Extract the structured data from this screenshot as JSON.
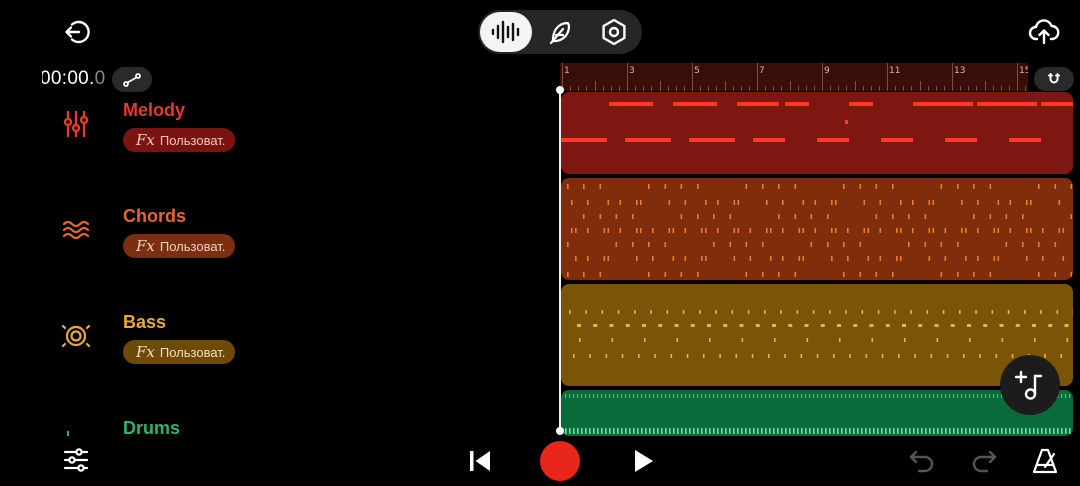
{
  "header": {
    "exit_icon": "exit-icon",
    "upload_icon": "cloud-upload-icon",
    "modes": [
      {
        "name": "waveform",
        "icon": "waveform-icon",
        "active": true
      },
      {
        "name": "feather",
        "icon": "feather-icon",
        "active": false
      },
      {
        "name": "settings",
        "icon": "hexagon-settings-icon",
        "active": false
      }
    ]
  },
  "transport": {
    "time_main": "00:00.",
    "time_frac": "0",
    "time_prefix": ")"
  },
  "ruler": {
    "numbers": [
      "1",
      "3",
      "5",
      "7",
      "9",
      "11",
      "13",
      "15"
    ]
  },
  "tracks": [
    {
      "name": "Melody",
      "fx_label": "Fx",
      "preset": "Пользоват.",
      "color": "#e63a2e",
      "fx_bg": "#7a1410",
      "lane_color": "#7e1712",
      "icon": "sliders-vertical-icon"
    },
    {
      "name": "Chords",
      "fx_label": "Fx",
      "preset": "Пользоват.",
      "color": "#e8662e",
      "fx_bg": "#7a3010",
      "lane_color": "#7f2d0b",
      "icon": "waves-icon"
    },
    {
      "name": "Bass",
      "fx_label": "Fx",
      "preset": "Пользоват.",
      "color": "#e8a93a",
      "fx_bg": "#6e4a08",
      "lane_color": "#7a5408",
      "icon": "speaker-icon"
    },
    {
      "name": "Drums",
      "color": "#2fb56b",
      "lane_color": "#0a6b3a",
      "icon": "drum-icon"
    }
  ],
  "footer": {
    "mixer_icon": "mixer-sliders-icon",
    "skip_back_icon": "skip-back-icon",
    "record_icon": "record-icon",
    "play_icon": "play-icon",
    "undo_icon": "undo-icon",
    "redo_icon": "redo-icon",
    "metronome_icon": "metronome-icon",
    "add_track_icon": "add-track-icon"
  },
  "colors": {
    "record": "#e8261a",
    "ruler_bg": "#3a0e08"
  }
}
